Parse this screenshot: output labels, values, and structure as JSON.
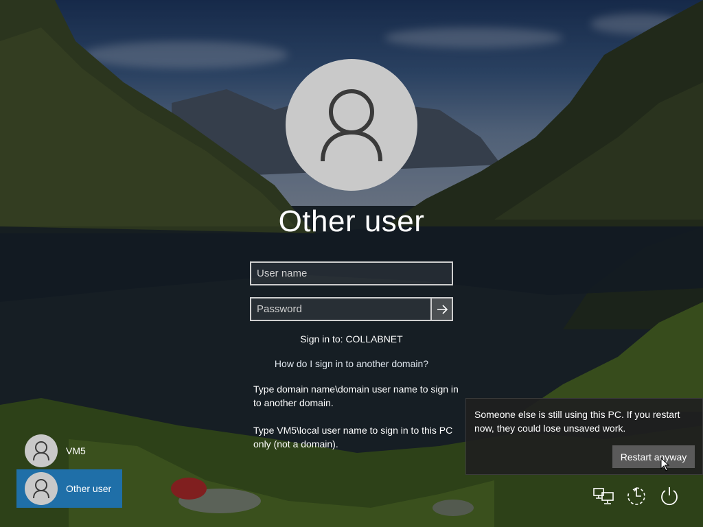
{
  "login": {
    "title": "Other user",
    "username_placeholder": "User name",
    "password_placeholder": "Password",
    "signin_to": "Sign in to: COLLABNET",
    "help_link": "How do I sign in to another domain?",
    "hint_domain": "Type domain name\\domain user name to sign in to another domain.",
    "hint_local": "Type VM5\\local user name to sign in to this PC only (not a domain)."
  },
  "users": [
    {
      "name": "VM5"
    },
    {
      "name": "Other user"
    }
  ],
  "flyout": {
    "message": "Someone else is still using this PC. If you restart now, they could lose unsaved work.",
    "button_label": "Restart anyway"
  },
  "system_icons": [
    "network-icon",
    "ease-of-access-icon",
    "power-icon"
  ],
  "colors": {
    "selected_user_bg": "#1f6fa8",
    "flyout_bg": "#202020",
    "avatar_bg": "#c9c9c9"
  }
}
